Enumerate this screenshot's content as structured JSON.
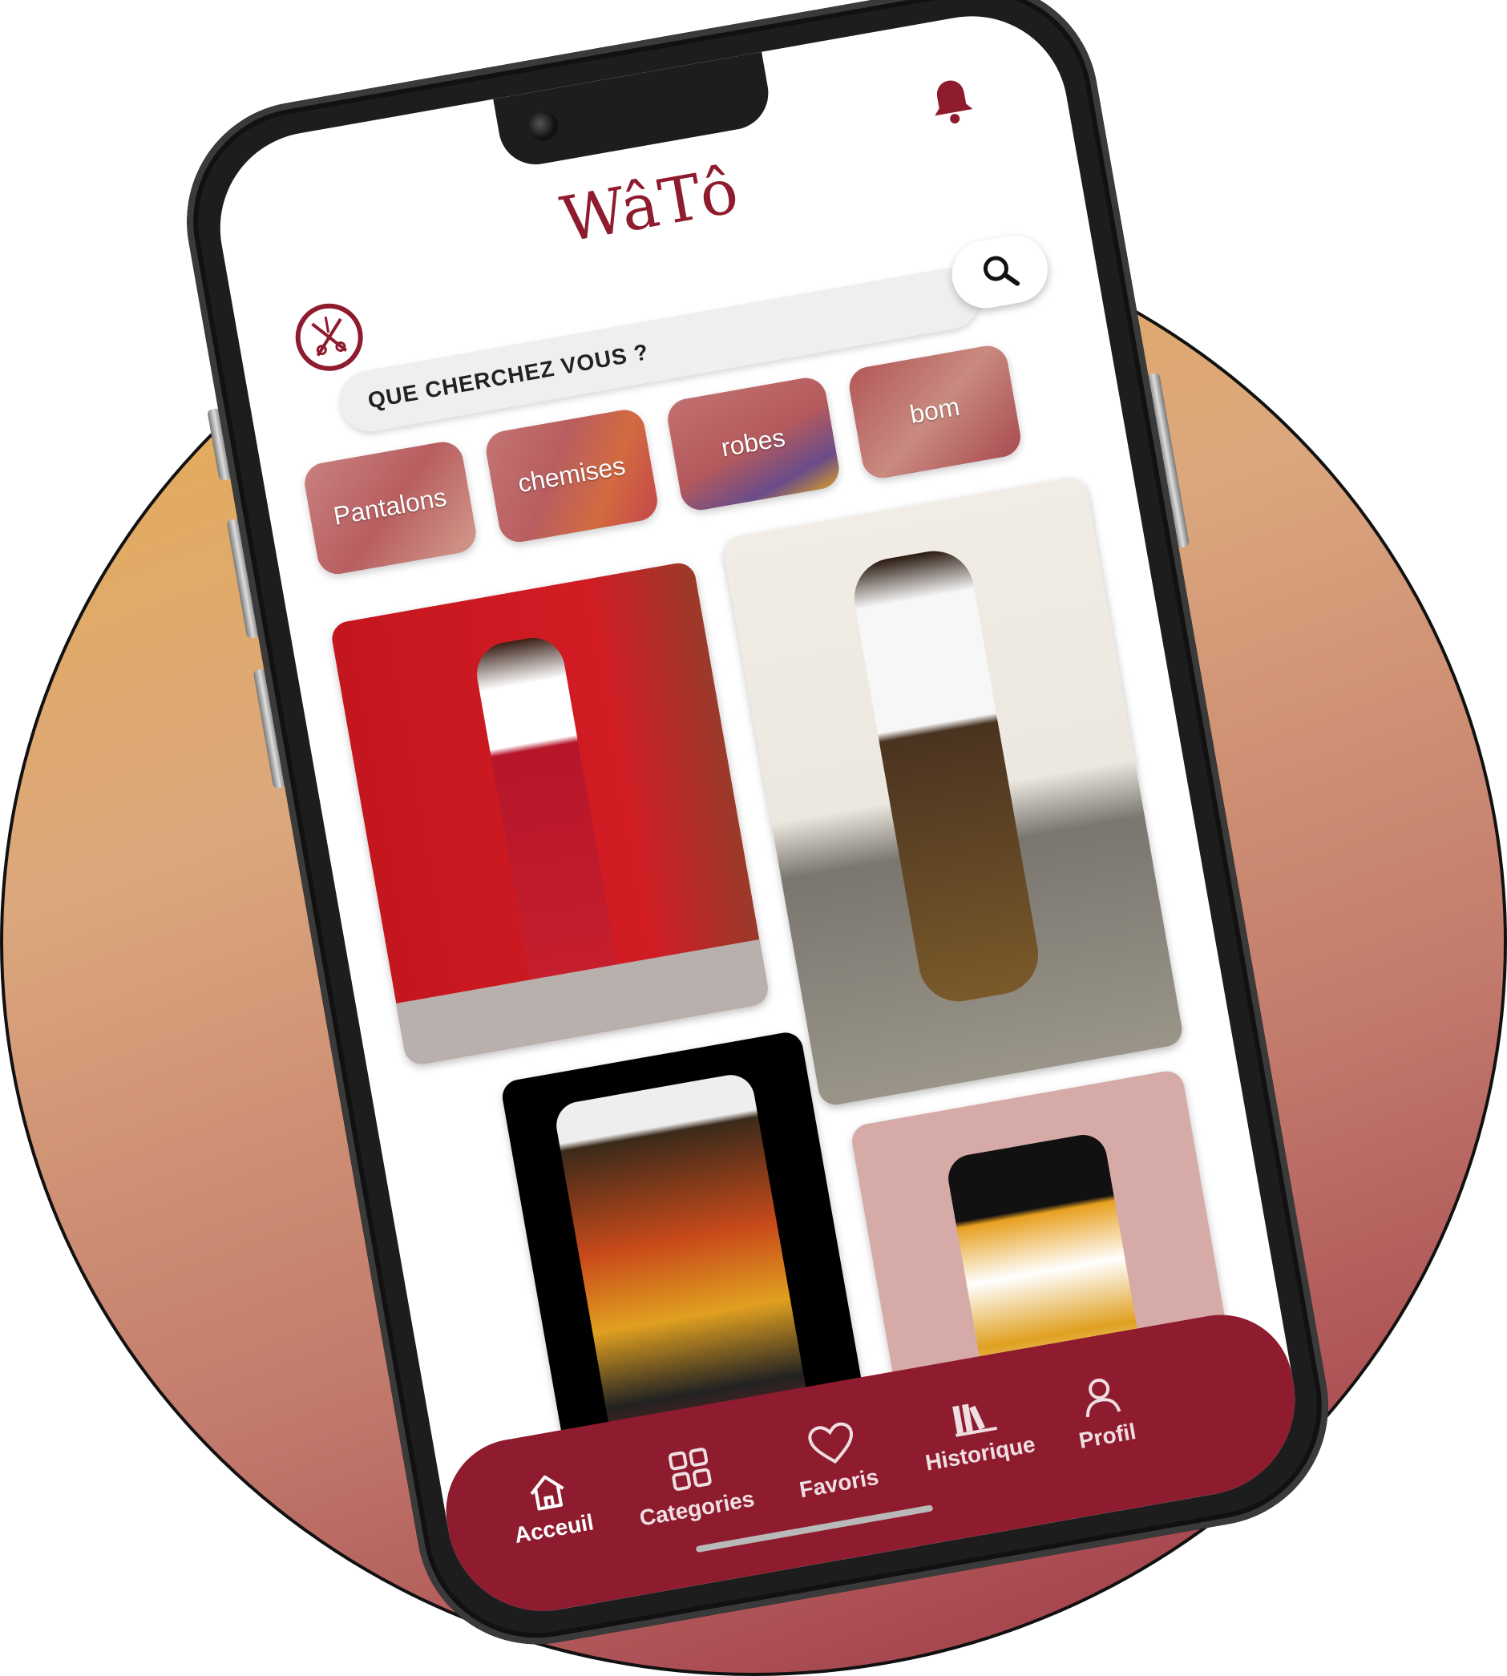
{
  "app": {
    "name": "WâTô"
  },
  "search": {
    "placeholder": "QUE CHERCHEZ VOUS ?"
  },
  "categories": [
    {
      "label": "Pantalons"
    },
    {
      "label": "chemises"
    },
    {
      "label": "robes"
    },
    {
      "label": "bom"
    }
  ],
  "nav": {
    "items": [
      {
        "label": "Acceuil",
        "icon": "home-icon"
      },
      {
        "label": "Categories",
        "icon": "grid-icon"
      },
      {
        "label": "Favoris",
        "icon": "heart-icon"
      },
      {
        "label": "Historique",
        "icon": "books-icon"
      },
      {
        "label": "Profil",
        "icon": "user-icon"
      }
    ]
  },
  "colors": {
    "brand": "#8e1b2e",
    "category_tile": "#b85e60",
    "backdrop_top": "#e8ae48",
    "backdrop_bottom": "#9a2f43"
  }
}
